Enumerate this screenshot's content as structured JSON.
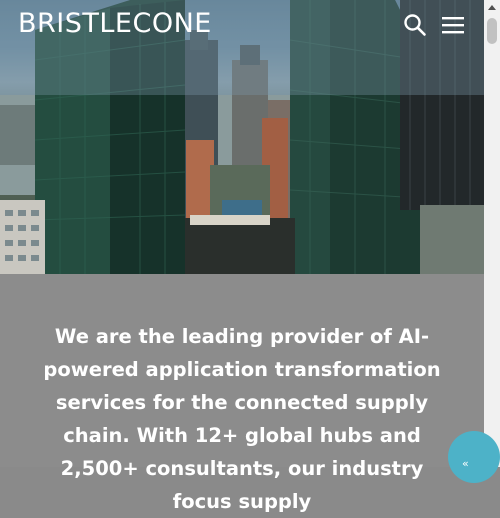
{
  "header": {
    "logo_text": "BRISTLECONE",
    "search_icon": "search-icon",
    "menu_icon": "hamburger-menu-icon"
  },
  "hero": {
    "image_alt": "Downtown city skyline with glass skyscrapers",
    "sky_color": "#7a97a8",
    "glass_color": "#1f4a3a"
  },
  "intro": {
    "text": "We are the leading provider of AI-powered application transformation services for the connected supply chain. With 12+ global hubs and 2,500+ consultants, our industry focus supply"
  },
  "colors": {
    "accent": "#4db2c8",
    "content_bg": "#8c8c8c",
    "text": "#ffffff"
  },
  "chat": {
    "icon": "chat-icon",
    "label": "«"
  }
}
